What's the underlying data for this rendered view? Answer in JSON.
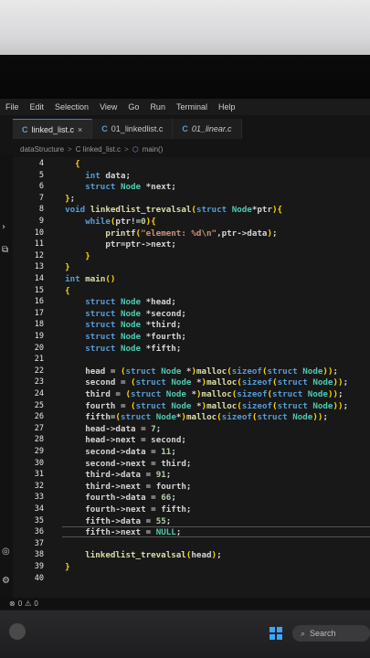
{
  "menu": [
    "File",
    "Edit",
    "Selection",
    "View",
    "Go",
    "Run",
    "Terminal",
    "Help"
  ],
  "tabs": [
    {
      "label": "linked_list.c",
      "icon": "C",
      "close": "×",
      "active": true
    },
    {
      "label": "01_linkedlist.c",
      "icon": "C",
      "active": false
    },
    {
      "label": "01_linear.c",
      "icon": "C",
      "active": false
    }
  ],
  "breadcrumb": {
    "folder": "dataStructure",
    "file": "C linked_list.c",
    "symbol": "main()",
    "sep": ">"
  },
  "code": [
    {
      "n": "4",
      "t": "    {"
    },
    {
      "n": "5",
      "t": "      int data;"
    },
    {
      "n": "6",
      "t": "      struct Node *next;"
    },
    {
      "n": "7",
      "t": "  };"
    },
    {
      "n": "8",
      "t": "  void linkedlist_trevalsal(struct Node*ptr){"
    },
    {
      "n": "9",
      "t": "      while(ptr!=0){"
    },
    {
      "n": "10",
      "t": "          printf(\"element: %d\\n\",ptr->data);"
    },
    {
      "n": "11",
      "t": "          ptr=ptr->next;"
    },
    {
      "n": "12",
      "t": "      }"
    },
    {
      "n": "13",
      "t": "  }"
    },
    {
      "n": "14",
      "t": "  int main()"
    },
    {
      "n": "15",
      "t": "  {"
    },
    {
      "n": "16",
      "t": "      struct Node *head;"
    },
    {
      "n": "17",
      "t": "      struct Node *second;"
    },
    {
      "n": "18",
      "t": "      struct Node *third;"
    },
    {
      "n": "19",
      "t": "      struct Node *fourth;"
    },
    {
      "n": "20",
      "t": "      struct Node *fifth;"
    },
    {
      "n": "21",
      "t": ""
    },
    {
      "n": "22",
      "t": "      head = (struct Node *)malloc(sizeof(struct Node));"
    },
    {
      "n": "23",
      "t": "      second = (struct Node *)malloc(sizeof(struct Node));"
    },
    {
      "n": "24",
      "t": "      third = (struct Node *)malloc(sizeof(struct Node));"
    },
    {
      "n": "25",
      "t": "      fourth = (struct Node *)malloc(sizeof(struct Node));"
    },
    {
      "n": "26",
      "t": "      fifth=(struct Node*)malloc(sizeof(struct Node));"
    },
    {
      "n": "27",
      "t": "      head->data = 7;"
    },
    {
      "n": "28",
      "t": "      head->next = second;"
    },
    {
      "n": "29",
      "t": "      second->data = 11;"
    },
    {
      "n": "30",
      "t": "      second->next = third;"
    },
    {
      "n": "31",
      "t": "      third->data = 91;"
    },
    {
      "n": "32",
      "t": "      third->next = fourth;"
    },
    {
      "n": "33",
      "t": "      fourth->data = 66;"
    },
    {
      "n": "34",
      "t": "      fourth->next = fifth;"
    },
    {
      "n": "35",
      "t": "      fifth->data = 55;"
    },
    {
      "n": "36",
      "t": "      fifth->next = NULL;"
    },
    {
      "n": "37",
      "t": ""
    },
    {
      "n": "38",
      "t": "      linkedlist_trevalsal(head);"
    },
    {
      "n": "39",
      "t": "  }"
    },
    {
      "n": "40",
      "t": ""
    }
  ],
  "status": {
    "errors": "0",
    "warnings": "0"
  },
  "taskbar": {
    "search_label": "Search"
  },
  "colors": {
    "keyword": "#569cd6",
    "type": "#4ec9b0",
    "function": "#dcdcaa",
    "string": "#ce9178",
    "number": "#b5cea8",
    "accent": "#3a7bd5"
  }
}
